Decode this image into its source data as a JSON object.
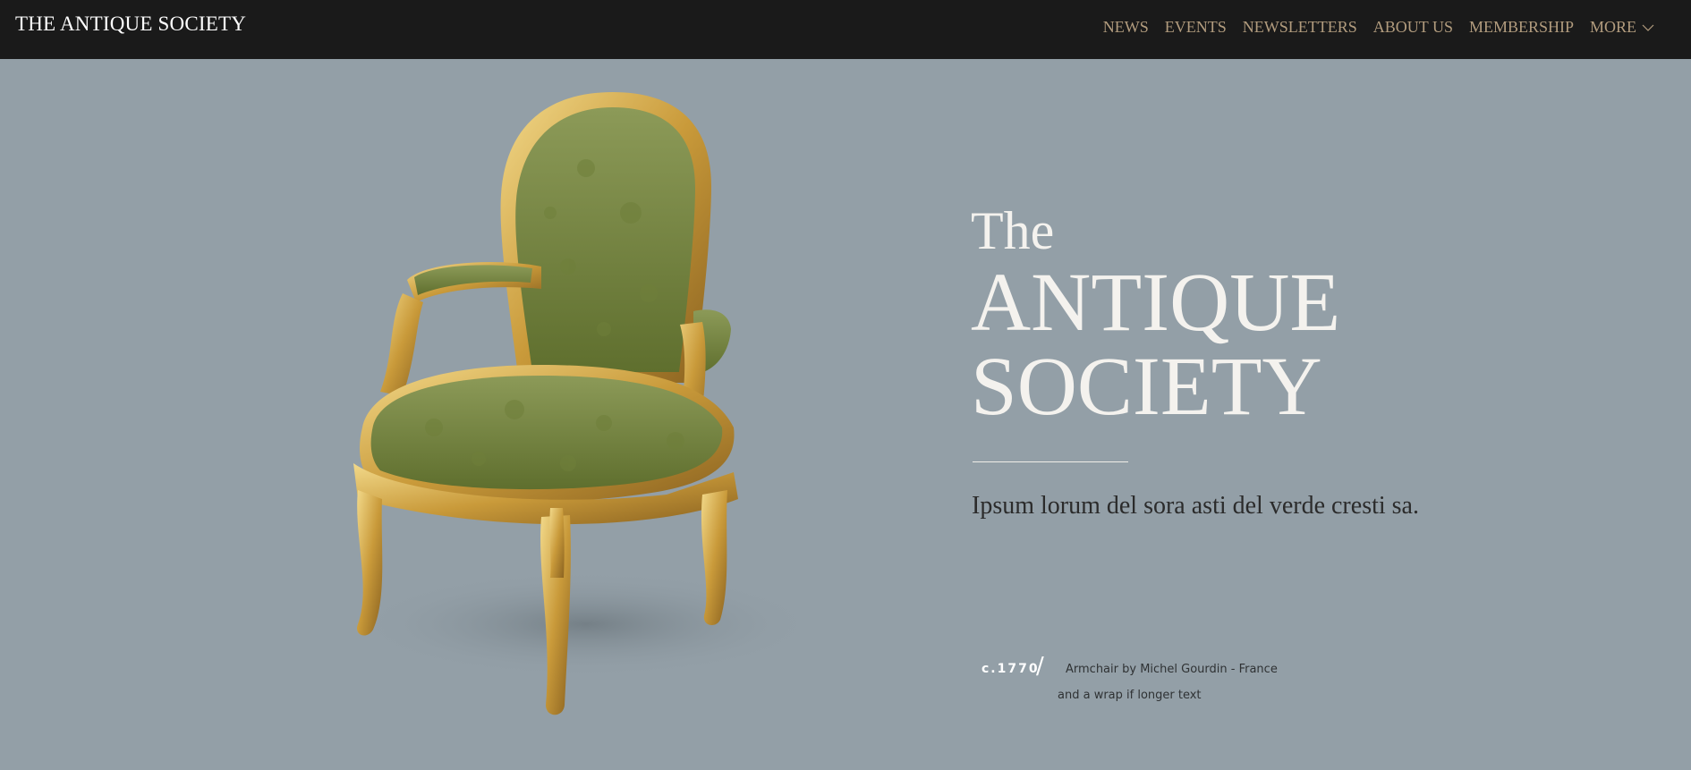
{
  "header": {
    "brand": "THE ANTIQUE SOCIETY",
    "nav": [
      "NEWS",
      "EVENTS",
      "NEWSLETTERS",
      "ABOUT US",
      "MEMBERSHIP"
    ],
    "more_label": "MORE",
    "more_icon": "chevron-down-icon"
  },
  "hero": {
    "kicker": "The",
    "title_line1": "ANTIQUE",
    "title_line2": "SOCIETY",
    "subtitle": "Ipsum lorum del sora asti del verde cresti sa."
  },
  "caption": {
    "date": "c.1770",
    "separator": "/",
    "line1": "Armchair by Michel Gourdin - France",
    "line2": "and a wrap if longer text"
  },
  "colors": {
    "header_bg": "#1a1a1a",
    "page_bg": "#939fa7",
    "nav_text": "#b29c7e",
    "hero_text": "#f4f2ee"
  }
}
